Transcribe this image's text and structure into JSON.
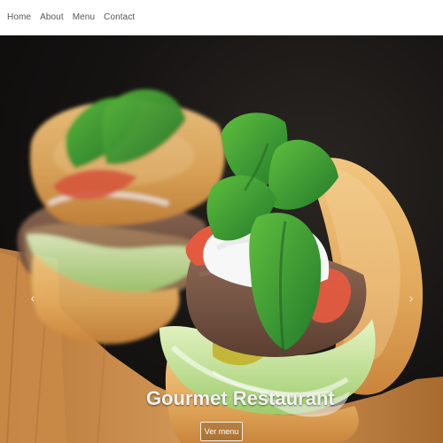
{
  "nav": {
    "items": [
      {
        "label": "Home"
      },
      {
        "label": "About"
      },
      {
        "label": "Menu"
      },
      {
        "label": "Contact"
      }
    ]
  },
  "hero": {
    "title": "Gourmet Restaurant",
    "cta_label": "Ver menu",
    "arrows": {
      "prev_glyph": "‹",
      "next_glyph": "›"
    }
  },
  "icons": {
    "prev": "chevron-left-icon",
    "next": "chevron-right-icon"
  }
}
